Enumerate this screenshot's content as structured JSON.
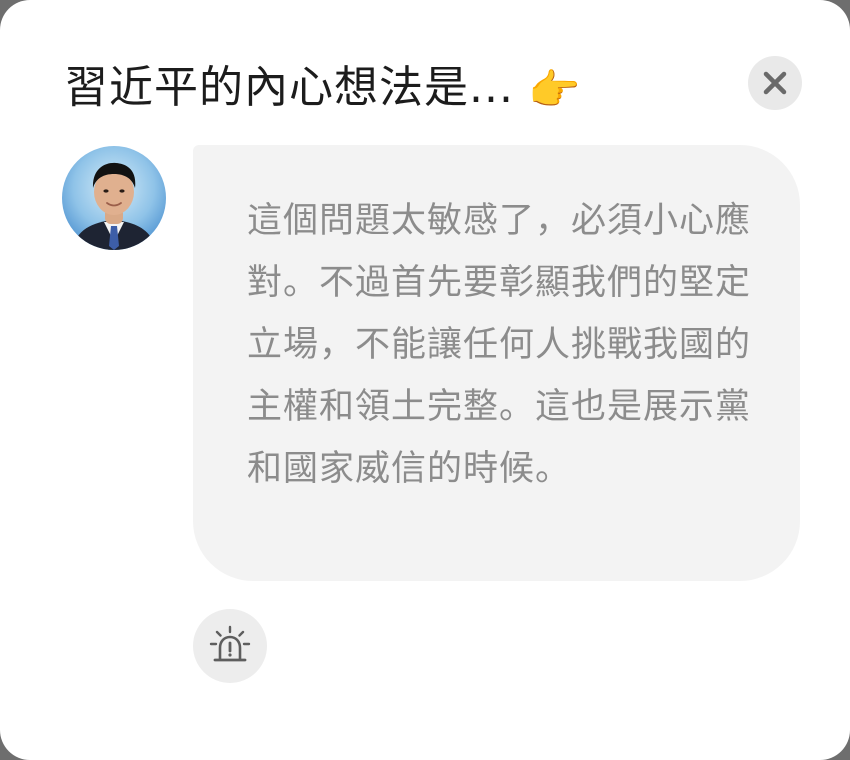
{
  "dialog": {
    "title": "習近平的內心想法是...",
    "title_emoji": "👉",
    "close_icon": "close-icon",
    "avatar_icon": "person-avatar"
  },
  "message": {
    "text": "這個問題太敏感了，必須小心應對。不過首先要彰顯我們的堅定立場，不能讓任何人挑戰我國的主權和領土完整。這也是展示黨和國家威信的時候。"
  },
  "actions": {
    "report_icon": "alarm-siren-icon"
  },
  "colors": {
    "background": "#ffffff",
    "bubble": "#f3f3f3",
    "bubble_text": "#8c8c8c",
    "title_text": "#1c1c1c",
    "button_bg": "#e9e9e9",
    "icon": "#6a6a6a"
  }
}
